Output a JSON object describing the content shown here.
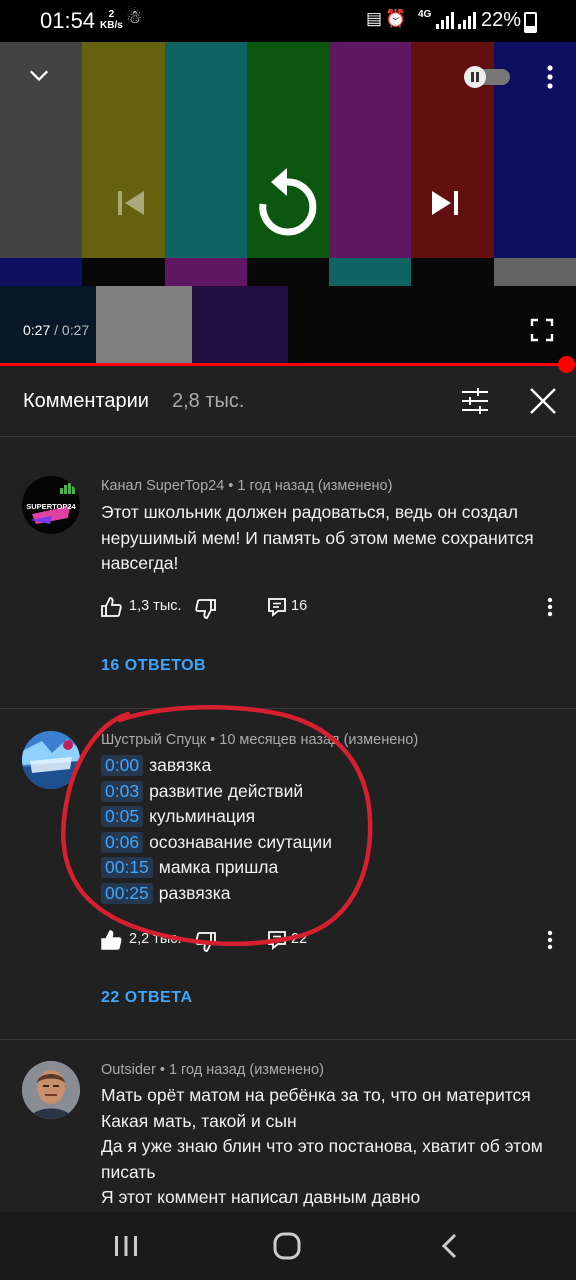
{
  "status_bar": {
    "time": "01:54",
    "net_speed_value": "2",
    "net_speed_unit": "KB/s",
    "network": "4G",
    "battery": "22%"
  },
  "player": {
    "current_time": "0:27",
    "separator": "/",
    "duration": "0:27",
    "progress_fraction": 1.0,
    "accent_color": "#ff0000",
    "bars_top": [
      "#7a7a7a",
      "#b9b21c",
      "#1eb4b4",
      "#169e1c",
      "#ae2ab6",
      "#b11c1c",
      "#1c1cb3"
    ],
    "bars_mid": [
      "#1c1cb3",
      "#101010",
      "#ae2ab6",
      "#101010",
      "#1eb4b4",
      "#101010",
      "#b5b5b5"
    ],
    "bars_bot": [
      "#0d2f4a",
      "#e9e9e9",
      "#3a1a73",
      "#101010",
      "#101010",
      "#101010",
      "#101010"
    ]
  },
  "comments_header": {
    "title": "Комментарии",
    "count": "2,8 тыс."
  },
  "comments": [
    {
      "author": "Канал SuperTop24",
      "time": "1 год назад (изменено)",
      "avatar_label": "SUPERTOP24",
      "lines": [
        "Этот школьник должен радоваться, ведь он создал",
        "нерушимый мем! И память об этом меме сохранится",
        "навсегда!"
      ],
      "likes": "1,3 тыс.",
      "replies_count": "16",
      "replies_label": "16 ОТВЕТОВ"
    },
    {
      "author": "Шустрый Спуцк",
      "time": "10 месяцев назад (изменено)",
      "timestamps": [
        {
          "t": "0:00",
          "label": "завязка"
        },
        {
          "t": "0:03",
          "label": "развитие действий"
        },
        {
          "t": "0:05",
          "label": "кульминация"
        },
        {
          "t": "0:06",
          "label": "осознавание сиутации"
        },
        {
          "t": "00:15",
          "label": "мамка пришла"
        },
        {
          "t": "00:25",
          "label": "развязка"
        }
      ],
      "likes": "2,2 тыс.",
      "replies_count": "22",
      "replies_label": "22 ОТВЕТА"
    },
    {
      "author": "Outsider",
      "time": "1 год назад (изменено)",
      "lines": [
        "Мать орёт матом на ребёнка за то, что он матерится",
        "Какая мать, такой и сын",
        "Да я уже знаю блин что это постанова, хватит об этом",
        "писать",
        "Я этот коммент написал давным давно"
      ]
    }
  ],
  "annotation_color": "#d6202f"
}
